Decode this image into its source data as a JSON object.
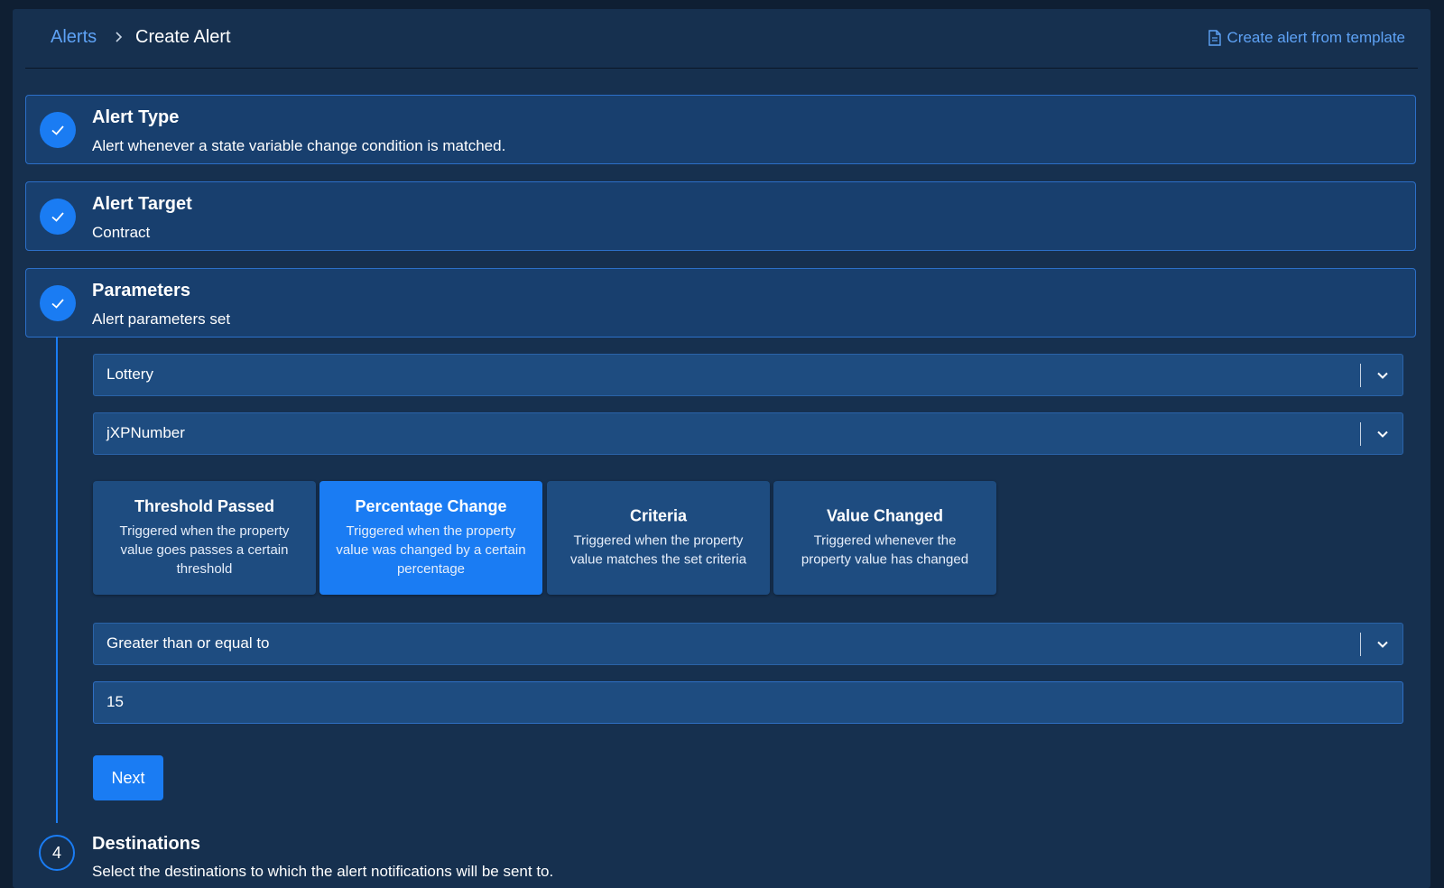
{
  "breadcrumb": {
    "parent": "Alerts",
    "current": "Create Alert"
  },
  "header": {
    "template_link": "Create alert from template"
  },
  "steps": [
    {
      "title": "Alert Type",
      "subtitle": "Alert whenever a state variable change condition is matched.",
      "status": "completed"
    },
    {
      "title": "Alert Target",
      "subtitle": "Contract",
      "status": "completed"
    },
    {
      "title": "Parameters",
      "subtitle": "Alert parameters set",
      "status": "completed"
    },
    {
      "number": "4",
      "title": "Destinations",
      "subtitle": "Select the destinations to which the alert notifications will be sent to.",
      "status": "pending"
    }
  ],
  "parameters": {
    "contract_select": "Lottery",
    "variable_select": "jXPNumber",
    "triggers": [
      {
        "title": "Threshold Passed",
        "description": "Triggered when the property value goes passes a certain threshold",
        "selected": false
      },
      {
        "title": "Percentage Change",
        "description": "Triggered when the property value was changed by a certain percentage",
        "selected": true
      },
      {
        "title": "Criteria",
        "description": "Triggered when the property value matches the set criteria",
        "selected": false
      },
      {
        "title": "Value Changed",
        "description": "Triggered whenever the property value has changed",
        "selected": false
      }
    ],
    "operator_select": "Greater than or equal to",
    "value_input": "15",
    "next_button": "Next"
  },
  "icons": {
    "check": "check-icon",
    "chevron": "chevron-down-icon",
    "breadcrumb_separator": "chevron-right-icon",
    "template": "document-icon"
  },
  "colors": {
    "background": "#0f1f33",
    "panel": "#16304f",
    "accent": "#1a7cf3",
    "link": "#5ea2f5",
    "step_card": "#183f6e",
    "field": "#1e4c80"
  }
}
